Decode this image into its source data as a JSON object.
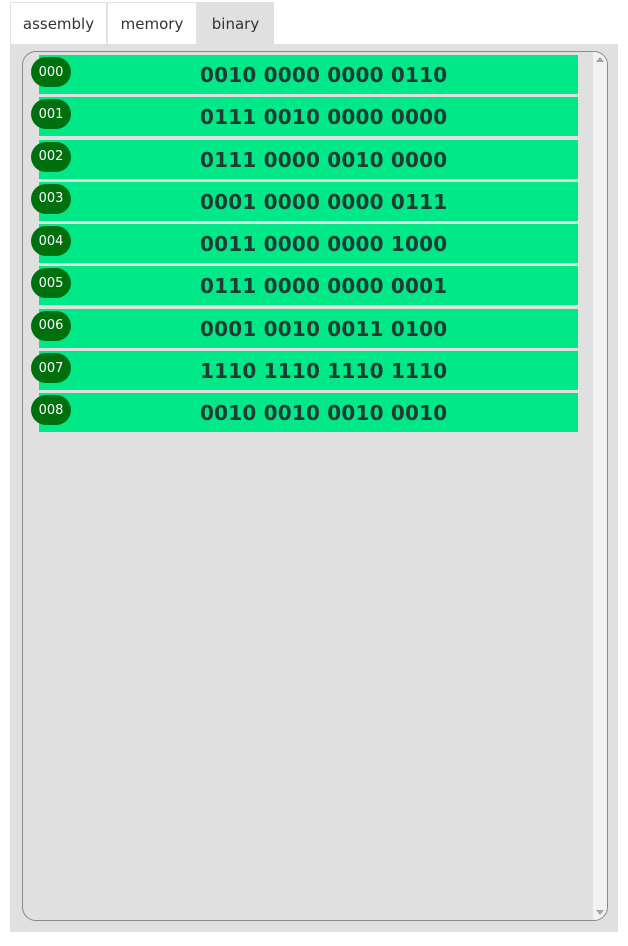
{
  "tabs": [
    {
      "label": "assembly",
      "active": false
    },
    {
      "label": "memory",
      "active": false
    },
    {
      "label": "binary",
      "active": true
    }
  ],
  "binary_rows": [
    {
      "address": "000",
      "bits": "0010 0000 0000 0110"
    },
    {
      "address": "001",
      "bits": "0111 0010 0000 0000"
    },
    {
      "address": "002",
      "bits": "0111 0000 0010 0000"
    },
    {
      "address": "003",
      "bits": "0001 0000 0000 0111"
    },
    {
      "address": "004",
      "bits": "0011 0000 0000 1000"
    },
    {
      "address": "005",
      "bits": "0111 0000 0000 0001"
    },
    {
      "address": "006",
      "bits": "0001 0010 0011 0100"
    },
    {
      "address": "007",
      "bits": "1110 1110 1110 1110"
    },
    {
      "address": "008",
      "bits": "0010 0010 0010 0010"
    }
  ],
  "colors": {
    "row_bg": "#00e887",
    "address_badge_bg": "#006f0d",
    "panel_bg": "#e0e0e0",
    "bits_text": "#1f3b33"
  },
  "icons": {
    "scroll_up": "scroll-up-arrow-icon",
    "scroll_down": "scroll-down-arrow-icon"
  }
}
